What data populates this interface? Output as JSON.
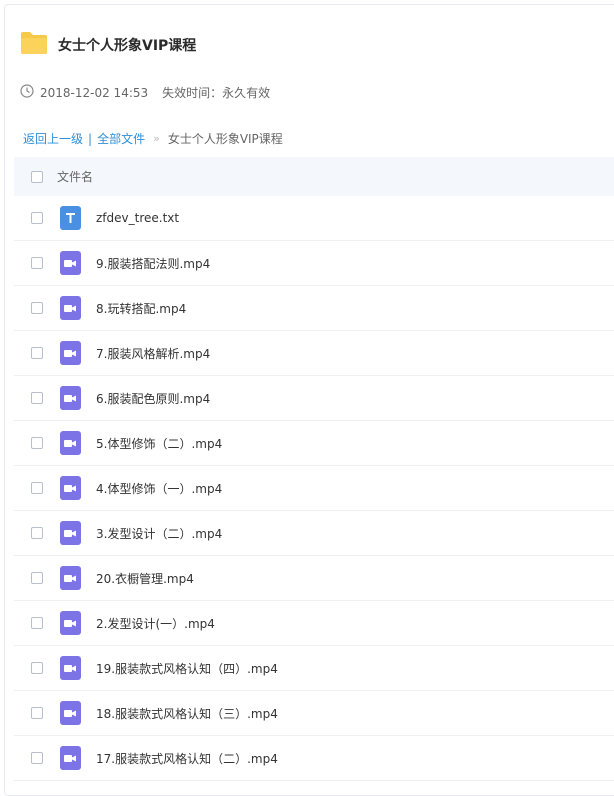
{
  "header": {
    "title": "女士个人形象VIP课程",
    "date": "2018-12-02 14:53",
    "expiry": "失效时间：永久有效"
  },
  "breadcrumb": {
    "back": "返回上一级",
    "separator": "|",
    "all_files": "全部文件",
    "arrow": "»",
    "current": "女士个人形象VIP课程"
  },
  "list": {
    "column_name": "文件名",
    "files": [
      {
        "name": "zfdev_tree.txt",
        "type": "text"
      },
      {
        "name": "9.服装搭配法则.mp4",
        "type": "video"
      },
      {
        "name": "8.玩转搭配.mp4",
        "type": "video"
      },
      {
        "name": "7.服装风格解析.mp4",
        "type": "video"
      },
      {
        "name": "6.服装配色原则.mp4",
        "type": "video"
      },
      {
        "name": "5.体型修饰（二）.mp4",
        "type": "video"
      },
      {
        "name": "4.体型修饰（一）.mp4",
        "type": "video"
      },
      {
        "name": "3.发型设计（二）.mp4",
        "type": "video"
      },
      {
        "name": "20.衣橱管理.mp4",
        "type": "video"
      },
      {
        "name": "2.发型设计(一）.mp4",
        "type": "video"
      },
      {
        "name": "19.服装款式风格认知（四）.mp4",
        "type": "video"
      },
      {
        "name": "18.服装款式风格认知（三）.mp4",
        "type": "video"
      },
      {
        "name": "17.服装款式风格认知（二）.mp4",
        "type": "video"
      }
    ]
  },
  "colors": {
    "folder": "#f7c948",
    "link": "#2f8fd8",
    "video_icon": "#7b73e6",
    "text_icon": "#4a90e2",
    "header_bg": "#f4f7fc"
  },
  "icons": {
    "folder": "folder-icon",
    "clock": "clock-icon",
    "video": "video-file-icon",
    "text": "text-file-icon"
  }
}
